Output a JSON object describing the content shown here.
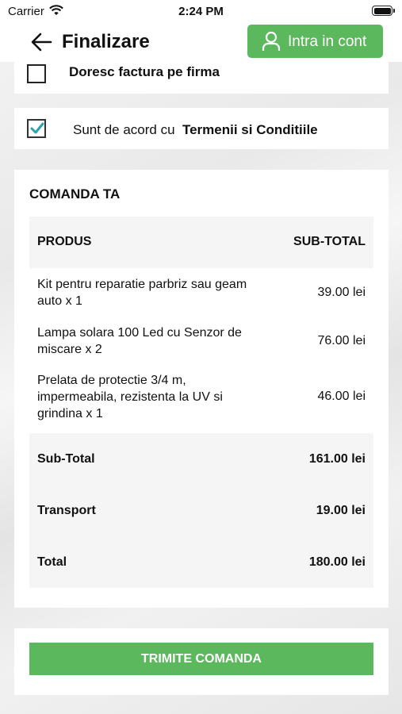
{
  "status_bar": {
    "carrier": "Carrier",
    "time": "2:24 PM"
  },
  "header": {
    "title": "Finalizare",
    "login_label": "Intra in cont",
    "accent_color": "#5cb85c"
  },
  "invoice_option": {
    "label": "Doresc factura pe firma",
    "checked": false
  },
  "terms": {
    "prefix": "Sunt de acord cu",
    "link": "Termenii si Conditiile",
    "checked": true,
    "check_color": "#2aa3b0"
  },
  "order": {
    "title": "COMANDA TA",
    "col_product": "PRODUS",
    "col_subtotal": "SUB-TOTAL",
    "items": [
      {
        "name": "Kit pentru reparatie parbriz sau geam auto x 1",
        "price": "39.00 lei"
      },
      {
        "name": "Lampa solara 100 Led cu Senzor de miscare x 2",
        "price": "76.00 lei"
      },
      {
        "name": "Prelata de protectie 3/4 m, impermeabila, rezistenta la UV si grindina x 1",
        "price": "46.00 lei"
      }
    ],
    "totals": [
      {
        "label": "Sub-Total",
        "value": "161.00 lei"
      },
      {
        "label": "Transport",
        "value": "19.00 lei"
      },
      {
        "label": "Total",
        "value": "180.00 lei"
      }
    ]
  },
  "submit_label": "TRIMITE COMANDA"
}
